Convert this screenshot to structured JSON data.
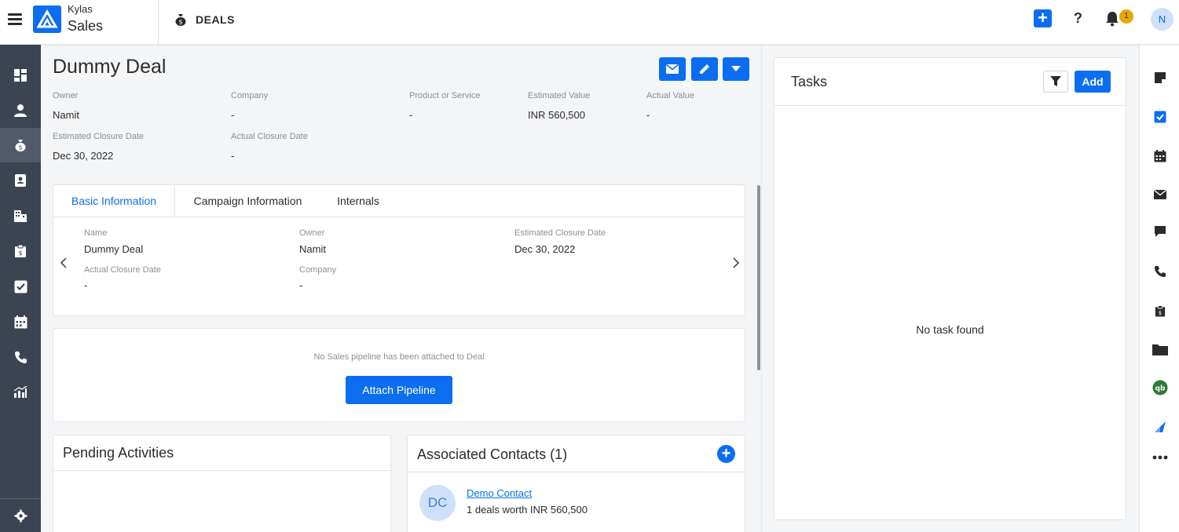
{
  "app": {
    "brand_small": "Kylas",
    "brand_large": "Sales",
    "module_title": "DEALS"
  },
  "topbar": {
    "notification_count": "1",
    "user_initial": "N",
    "help_label": "?"
  },
  "deal": {
    "title": "Dummy Deal",
    "fields": {
      "owner_label": "Owner",
      "owner_value": "Namit",
      "company_label": "Company",
      "company_value": "-",
      "product_label": "Product or Service",
      "product_value": "-",
      "est_value_label": "Estimated Value",
      "est_value_value": "INR 560,500",
      "actual_value_label": "Actual Value",
      "actual_value_value": "-",
      "est_close_label": "Estimated Closure Date",
      "est_close_value": "Dec 30, 2022",
      "actual_close_label": "Actual Closure Date",
      "actual_close_value": "-"
    }
  },
  "tabs": {
    "items": [
      "Basic Information",
      "Campaign Information",
      "Internals"
    ],
    "active": "Basic Information",
    "basic": {
      "name_label": "Name",
      "name_value": "Dummy Deal",
      "owner_label": "Owner",
      "owner_value": "Namit",
      "est_close_label": "Estimated Closure Date",
      "est_close_value": "Dec 30, 2022",
      "actual_close_label": "Actual Closure Date",
      "actual_close_value": "-",
      "company_label": "Company",
      "company_value": "-"
    }
  },
  "pipeline": {
    "empty_text": "No Sales pipeline has been attached to Deal",
    "button": "Attach Pipeline"
  },
  "pending": {
    "title": "Pending Activities"
  },
  "contacts": {
    "title": "Associated Contacts (1)",
    "items": [
      {
        "initials": "DC",
        "name": "Demo Contact",
        "summary": "1 deals worth INR 560,500"
      }
    ]
  },
  "tasks": {
    "title": "Tasks",
    "add_label": "Add",
    "empty_text": "No task found"
  },
  "icons": {
    "left_nav": [
      "dashboard-icon",
      "user-icon",
      "deal-moneybag-icon",
      "contact-card-icon",
      "company-building-icon",
      "quote-clipboard-icon",
      "task-check-icon",
      "calendar-icon",
      "phone-icon",
      "reports-chart-icon"
    ],
    "right_rail": [
      "note-icon",
      "task-check-icon",
      "calendar-icon",
      "email-icon",
      "chat-icon",
      "phone-icon",
      "quote-clipboard-icon",
      "folder-icon",
      "quickbooks-icon",
      "app-marketplace-icon",
      "more-icon"
    ]
  },
  "colors": {
    "primary": "#0b6ef0",
    "sidebar": "#3d4451",
    "badge": "#e6a800"
  }
}
